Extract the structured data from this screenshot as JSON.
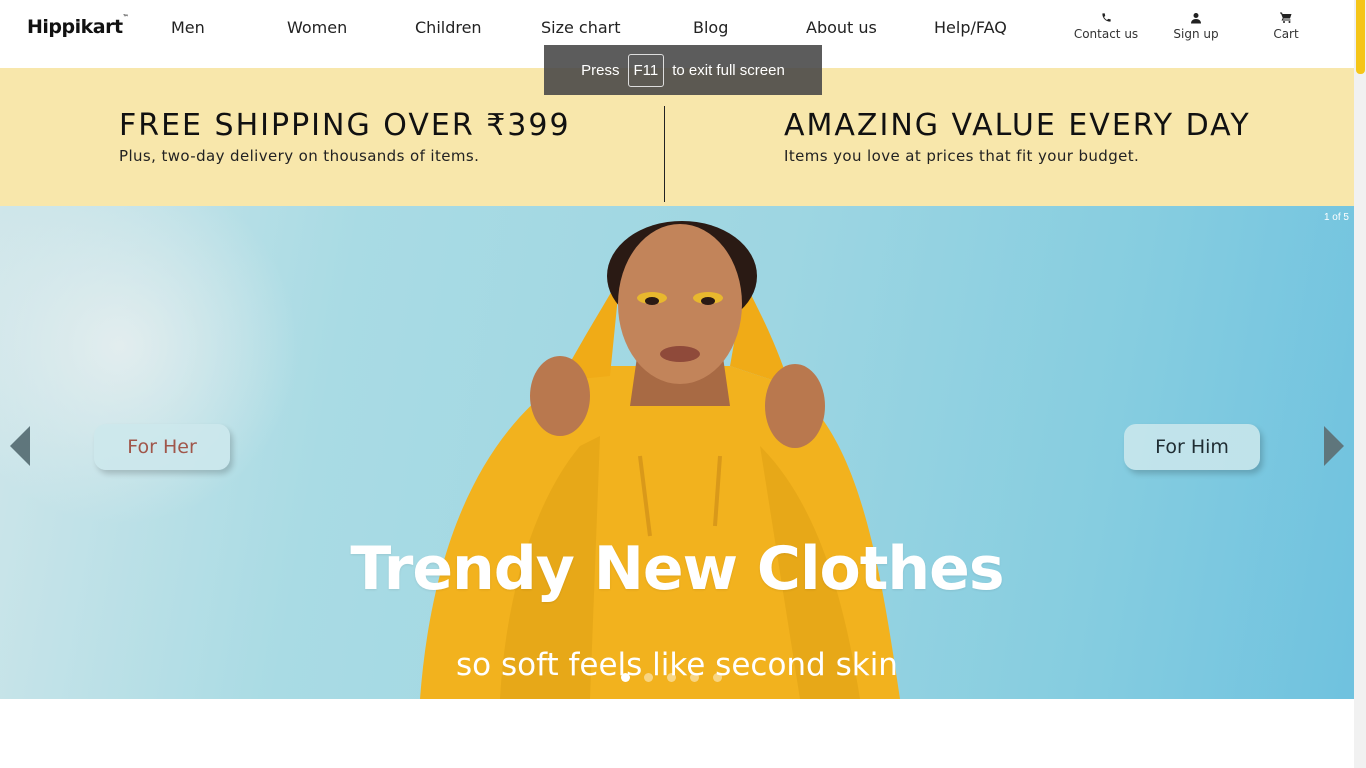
{
  "header": {
    "logo": "Hippikart",
    "logo_mark": "™",
    "nav": [
      "Men",
      "Women",
      "Children",
      "Size chart",
      "Blog",
      "About us",
      "Help/FAQ"
    ],
    "utilities": [
      {
        "label": "Contact us",
        "icon": "phone-icon"
      },
      {
        "label": "Sign up",
        "icon": "user-icon"
      },
      {
        "label": "Cart",
        "icon": "cart-icon"
      }
    ]
  },
  "fullscreen_toast": {
    "press": "Press",
    "key": "F11",
    "suffix": "to exit full screen"
  },
  "promo": {
    "left": {
      "title": "FREE SHIPPING OVER ₹399",
      "subtitle": "Plus, two-day delivery on thousands of items."
    },
    "right": {
      "title": "AMAZING VALUE EVERY DAY",
      "subtitle": "Items you love at prices that fit your budget."
    },
    "background": "#f8e7ab"
  },
  "hero": {
    "counter": "1 of 5",
    "for_her": "For Her",
    "for_him": "For Him",
    "title": "Trendy New Clothes",
    "subtitle": "so soft feels like second skin",
    "slides_total": 5,
    "active_slide": 1,
    "for_her_color": "#a0564a",
    "for_him_color": "#1f2d33"
  },
  "colors": {
    "accent": "#f5c518"
  }
}
